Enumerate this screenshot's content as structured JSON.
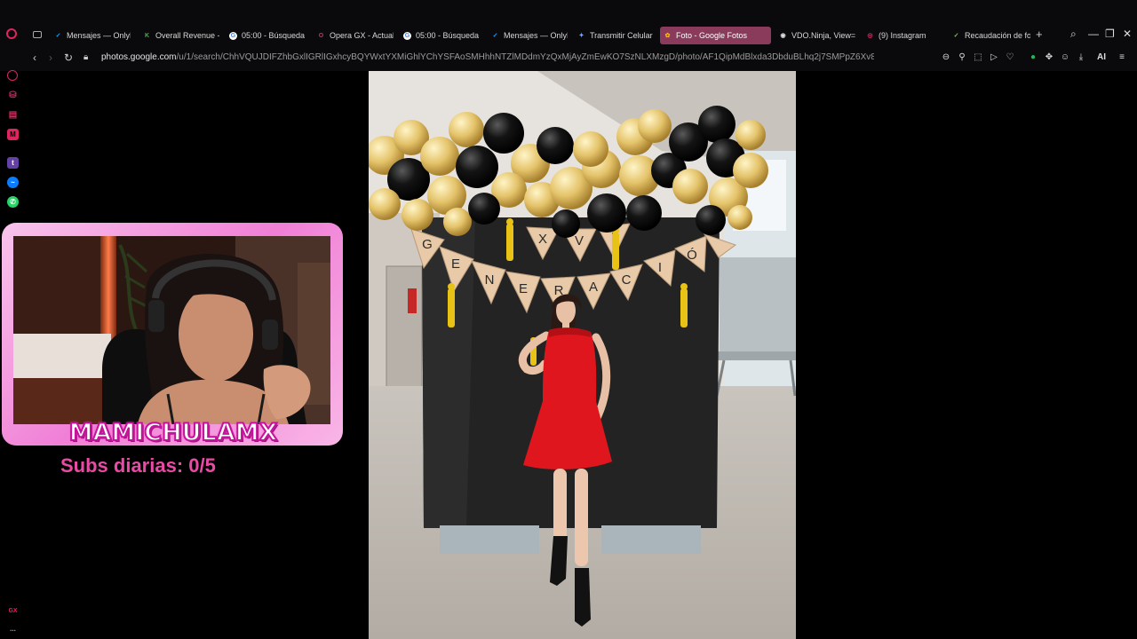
{
  "browser": {
    "tabs": [
      {
        "title": "Mensajes — OnlyF",
        "fav_color": "#1da1f2",
        "fav_char": "✓"
      },
      {
        "title": "Overall Revenue -",
        "fav_color": "#2e7d32",
        "fav_char": "K"
      },
      {
        "title": "05:00 - Búsqueda",
        "fav_color": "#ffffff",
        "fav_char": "G"
      },
      {
        "title": "Opera GX - Actual",
        "fav_color": "#e0245e",
        "fav_char": "O"
      },
      {
        "title": "05:00 - Búsqueda",
        "fav_color": "#ffffff",
        "fav_char": "G"
      },
      {
        "title": "Mensajes — OnlyF",
        "fav_color": "#1da1f2",
        "fav_char": "✓"
      },
      {
        "title": "Transmitir Celular",
        "fav_color": "#7aa7ff",
        "fav_char": "✦"
      },
      {
        "title": "Foto - Google Fotos",
        "fav_color": "#fbbc05",
        "fav_char": "✿"
      },
      {
        "title": "VDO.Ninja, View=",
        "fav_color": "#cccccc",
        "fav_char": "◉"
      },
      {
        "title": "(9) Instagram",
        "fav_color": "#e1306c",
        "fav_char": "◎"
      },
      {
        "title": "Recaudación de fo",
        "fav_color": "#8bc34a",
        "fav_char": "✓"
      }
    ],
    "add_tab_label": "+",
    "url_host": "photos.google.com",
    "url_path": "/u/1/search/ChhVQUJDIFZhbGxlIGRlIGxhcyBQYWxtYXMiGhlYChYSFAoSMHhhNTZlMDdmYzQxMjAyZmEwKO7SzNLXMzgD/photo/AF1QipMdBlxda3DbduBLhq2j7SMPpZ6Xv8W9CVoE4OVR",
    "ai_label": "AI"
  },
  "sidebar": {
    "icons": [
      "history-icon",
      "shopping-icon",
      "wallet-icon",
      "music-icon",
      "twitch-icon",
      "messenger-icon",
      "whatsapp-icon"
    ],
    "bottom_label": "GX",
    "more_label": "..."
  },
  "overlay": {
    "streamer_name": "MAMICHULAMX",
    "subs_text": "Subs diarias: 0/5"
  },
  "photo": {
    "banner_letters": [
      "G",
      "E",
      "N",
      "E",
      "R",
      "A",
      "C",
      "I",
      "Ó",
      "N",
      "X",
      "V",
      "I"
    ],
    "banner_text_top": "XVI",
    "dress_color": "#e0161e"
  }
}
